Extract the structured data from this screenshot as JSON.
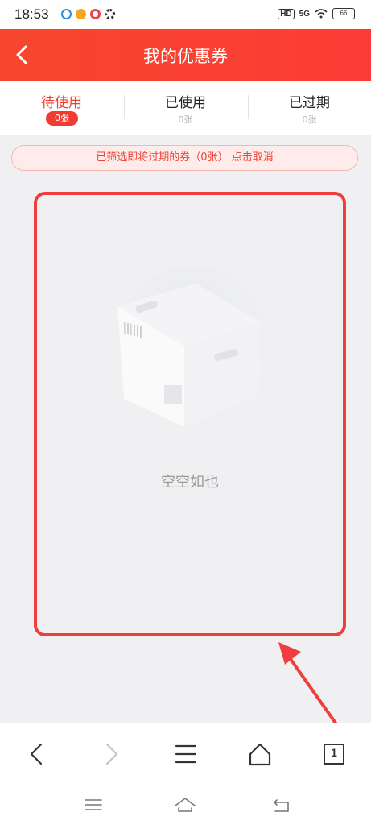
{
  "status_bar": {
    "time": "18:53",
    "hd": "HD",
    "network": "5G",
    "battery": "66"
  },
  "header": {
    "title": "我的优惠券"
  },
  "tabs": [
    {
      "label": "待使用",
      "count": "0张",
      "active": true
    },
    {
      "label": "已使用",
      "count": "0张",
      "active": false
    },
    {
      "label": "已过期",
      "count": "0张",
      "active": false
    }
  ],
  "filter_banner": {
    "text": "已筛选即将过期的券（0张） 点击取消"
  },
  "empty_state": {
    "text": "空空如也"
  },
  "browser_nav": {
    "tab_count": "1"
  },
  "colors": {
    "brand_red": "#f43c2f",
    "annotation_red": "#f03e3e"
  }
}
